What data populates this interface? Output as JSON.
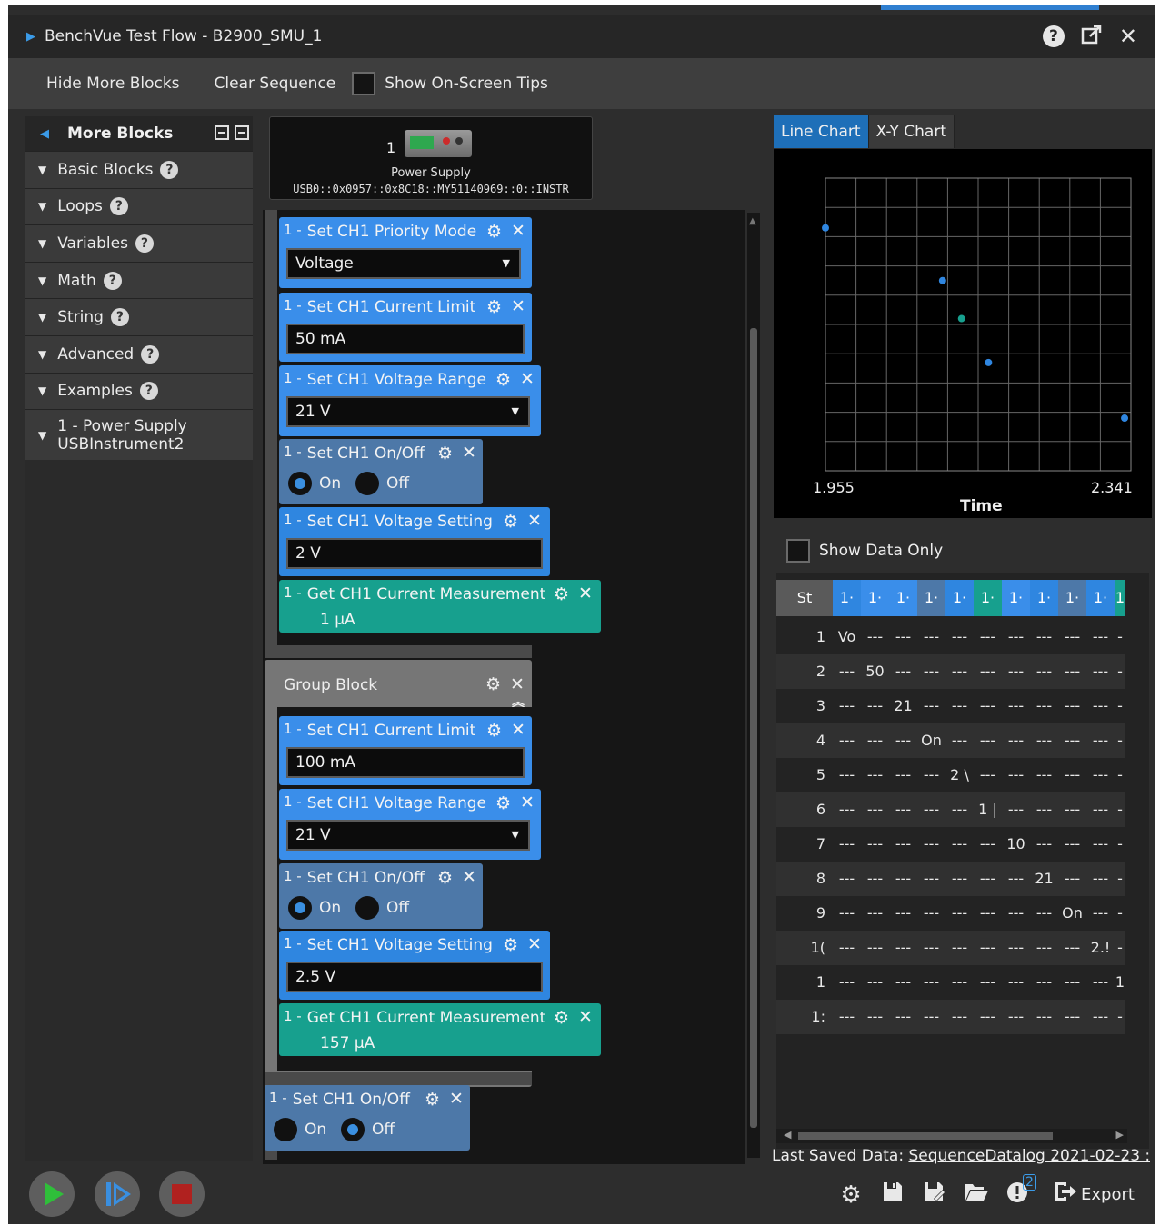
{
  "window": {
    "title": "BenchVue Test Flow - B2900_SMU_1",
    "help_icon": "?",
    "popout_icon": "popout-icon",
    "close_icon": "✕"
  },
  "toolbar": {
    "hide_more_blocks": "Hide More Blocks",
    "clear_sequence": "Clear Sequence",
    "show_tips": "Show On-Screen Tips"
  },
  "palette": {
    "title": "More Blocks",
    "items": [
      {
        "label": "Basic Blocks",
        "help": "?"
      },
      {
        "label": "Loops",
        "help": "?"
      },
      {
        "label": "Variables",
        "help": "?"
      },
      {
        "label": "Math",
        "help": "?"
      },
      {
        "label": "String",
        "help": "?"
      },
      {
        "label": "Advanced",
        "help": "?"
      },
      {
        "label": "Examples",
        "help": "?"
      }
    ],
    "instrument_item": {
      "line1": "1 - Power Supply",
      "line2": "USBInstrument2"
    }
  },
  "instrument": {
    "number": "1",
    "name": "Power Supply",
    "address": "USB0::0x0957::0x8C18::MY51140969::0::INSTR"
  },
  "blocks": {
    "prefix": "1 -",
    "b1": {
      "title": "Set CH1 Priority Mode",
      "value": "Voltage"
    },
    "b2": {
      "title": "Set CH1 Current Limit",
      "value": "50 mA"
    },
    "b3": {
      "title": "Set CH1 Voltage Range",
      "value": "21 V"
    },
    "b4": {
      "title": "Set CH1 On/Off",
      "on": "On",
      "off": "Off"
    },
    "b5": {
      "title": "Set CH1 Voltage Setting",
      "value": "2 V"
    },
    "b6": {
      "title": "Get CH1 Current Measurement",
      "value": "1 µA"
    },
    "group": {
      "title": "Group Block"
    },
    "g1": {
      "title": "Set CH1 Current Limit",
      "value": "100 mA"
    },
    "g2": {
      "title": "Set CH1 Voltage Range",
      "value": "21 V"
    },
    "g3": {
      "title": "Set CH1 On/Off",
      "on": "On",
      "off": "Off"
    },
    "g4": {
      "title": "Set CH1 Voltage Setting",
      "value": "2.5 V"
    },
    "g5": {
      "title": "Get CH1 Current Measurement",
      "value": "157 µA"
    },
    "last": {
      "title": "Set CH1 On/Off",
      "on": "On",
      "off": "Off"
    }
  },
  "chart_tabs": {
    "line": "Line Chart",
    "xy": "X-Y Chart"
  },
  "chart_data": {
    "type": "scatter",
    "xlabel": "Time",
    "x_tick_labels": [
      "1.955",
      "2.341"
    ],
    "xlim": [
      1.955,
      2.341
    ],
    "grid": true,
    "series": [
      {
        "color": "#2f86e0",
        "points": [
          [
            1.955,
            0.83
          ],
          [
            2.103,
            0.65
          ],
          [
            2.161,
            0.37
          ],
          [
            2.333,
            0.18
          ]
        ]
      },
      {
        "color": "#17a08e",
        "points": [
          [
            2.127,
            0.52
          ]
        ]
      }
    ],
    "colors": {
      "blue": "#2f86e0",
      "teal": "#17a08e"
    }
  },
  "table": {
    "show_data_only": "Show Data Only",
    "header": [
      "St",
      "1·",
      "1·",
      "1·",
      "1·",
      "1·",
      "1·",
      "1·",
      "1·",
      "1·",
      "1·",
      "1"
    ],
    "rows": [
      [
        "1",
        "Vo",
        "---",
        "---",
        "---",
        "---",
        "---",
        "---",
        "---",
        "---",
        "---",
        "-"
      ],
      [
        "2",
        "---",
        "50",
        "---",
        "---",
        "---",
        "---",
        "---",
        "---",
        "---",
        "---",
        "-"
      ],
      [
        "3",
        "---",
        "---",
        "21",
        "---",
        "---",
        "---",
        "---",
        "---",
        "---",
        "---",
        "-"
      ],
      [
        "4",
        "---",
        "---",
        "---",
        "On",
        "---",
        "---",
        "---",
        "---",
        "---",
        "---",
        "-"
      ],
      [
        "5",
        "---",
        "---",
        "---",
        "---",
        "2 \\",
        "---",
        "---",
        "---",
        "---",
        "---",
        "-"
      ],
      [
        "6",
        "---",
        "---",
        "---",
        "---",
        "---",
        "1 |",
        "---",
        "---",
        "---",
        "---",
        "-"
      ],
      [
        "7",
        "---",
        "---",
        "---",
        "---",
        "---",
        "---",
        "10",
        "---",
        "---",
        "---",
        "-"
      ],
      [
        "8",
        "---",
        "---",
        "---",
        "---",
        "---",
        "---",
        "---",
        "21",
        "---",
        "---",
        "-"
      ],
      [
        "9",
        "---",
        "---",
        "---",
        "---",
        "---",
        "---",
        "---",
        "---",
        "On",
        "---",
        "-"
      ],
      [
        "1(",
        "---",
        "---",
        "---",
        "---",
        "---",
        "---",
        "---",
        "---",
        "---",
        "2.!",
        "-"
      ],
      [
        "1",
        "---",
        "---",
        "---",
        "---",
        "---",
        "---",
        "---",
        "---",
        "---",
        "---",
        "1"
      ],
      [
        "1:",
        "---",
        "---",
        "---",
        "---",
        "---",
        "---",
        "---",
        "---",
        "---",
        "---",
        "-"
      ]
    ]
  },
  "footer": {
    "last_saved_label": "Last Saved Data:",
    "last_saved_link": "SequenceDatalog 2021-02-23 :",
    "notification_count": "2",
    "export": "Export"
  }
}
